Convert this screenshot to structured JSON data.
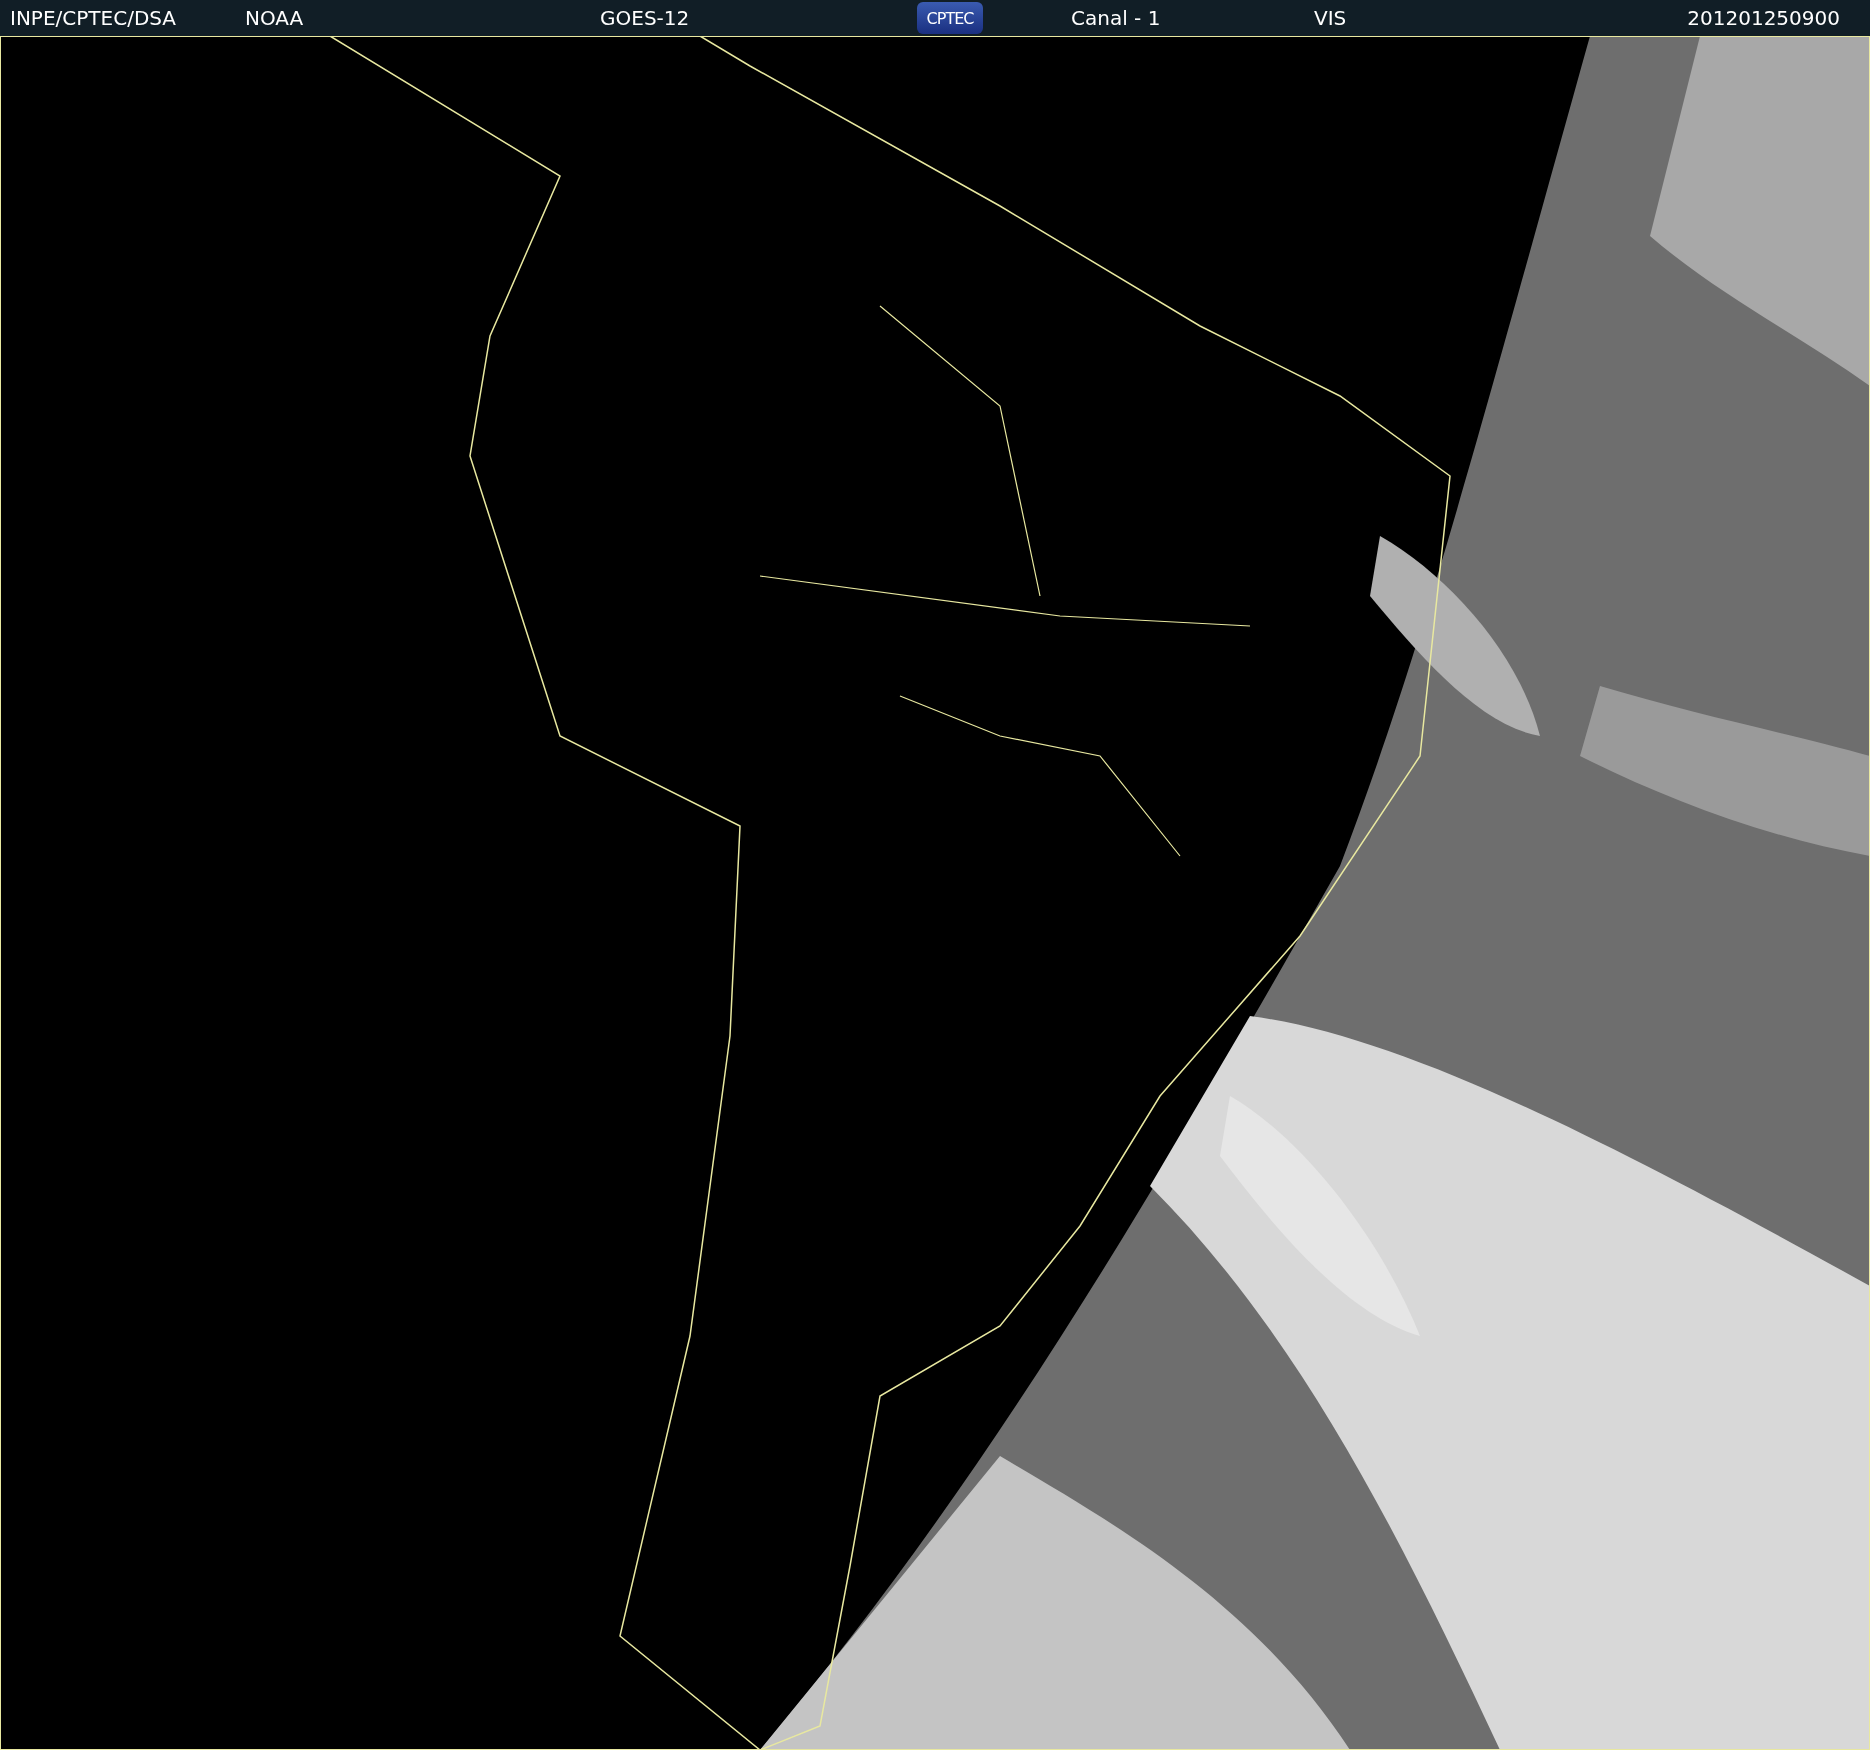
{
  "header": {
    "source": "INPE/CPTEC/DSA",
    "agency": "NOAA",
    "satellite": "GOES-12",
    "logo": "CPTEC",
    "channel": "Canal - 1",
    "band": "VIS",
    "timestamp": "201201250900"
  }
}
